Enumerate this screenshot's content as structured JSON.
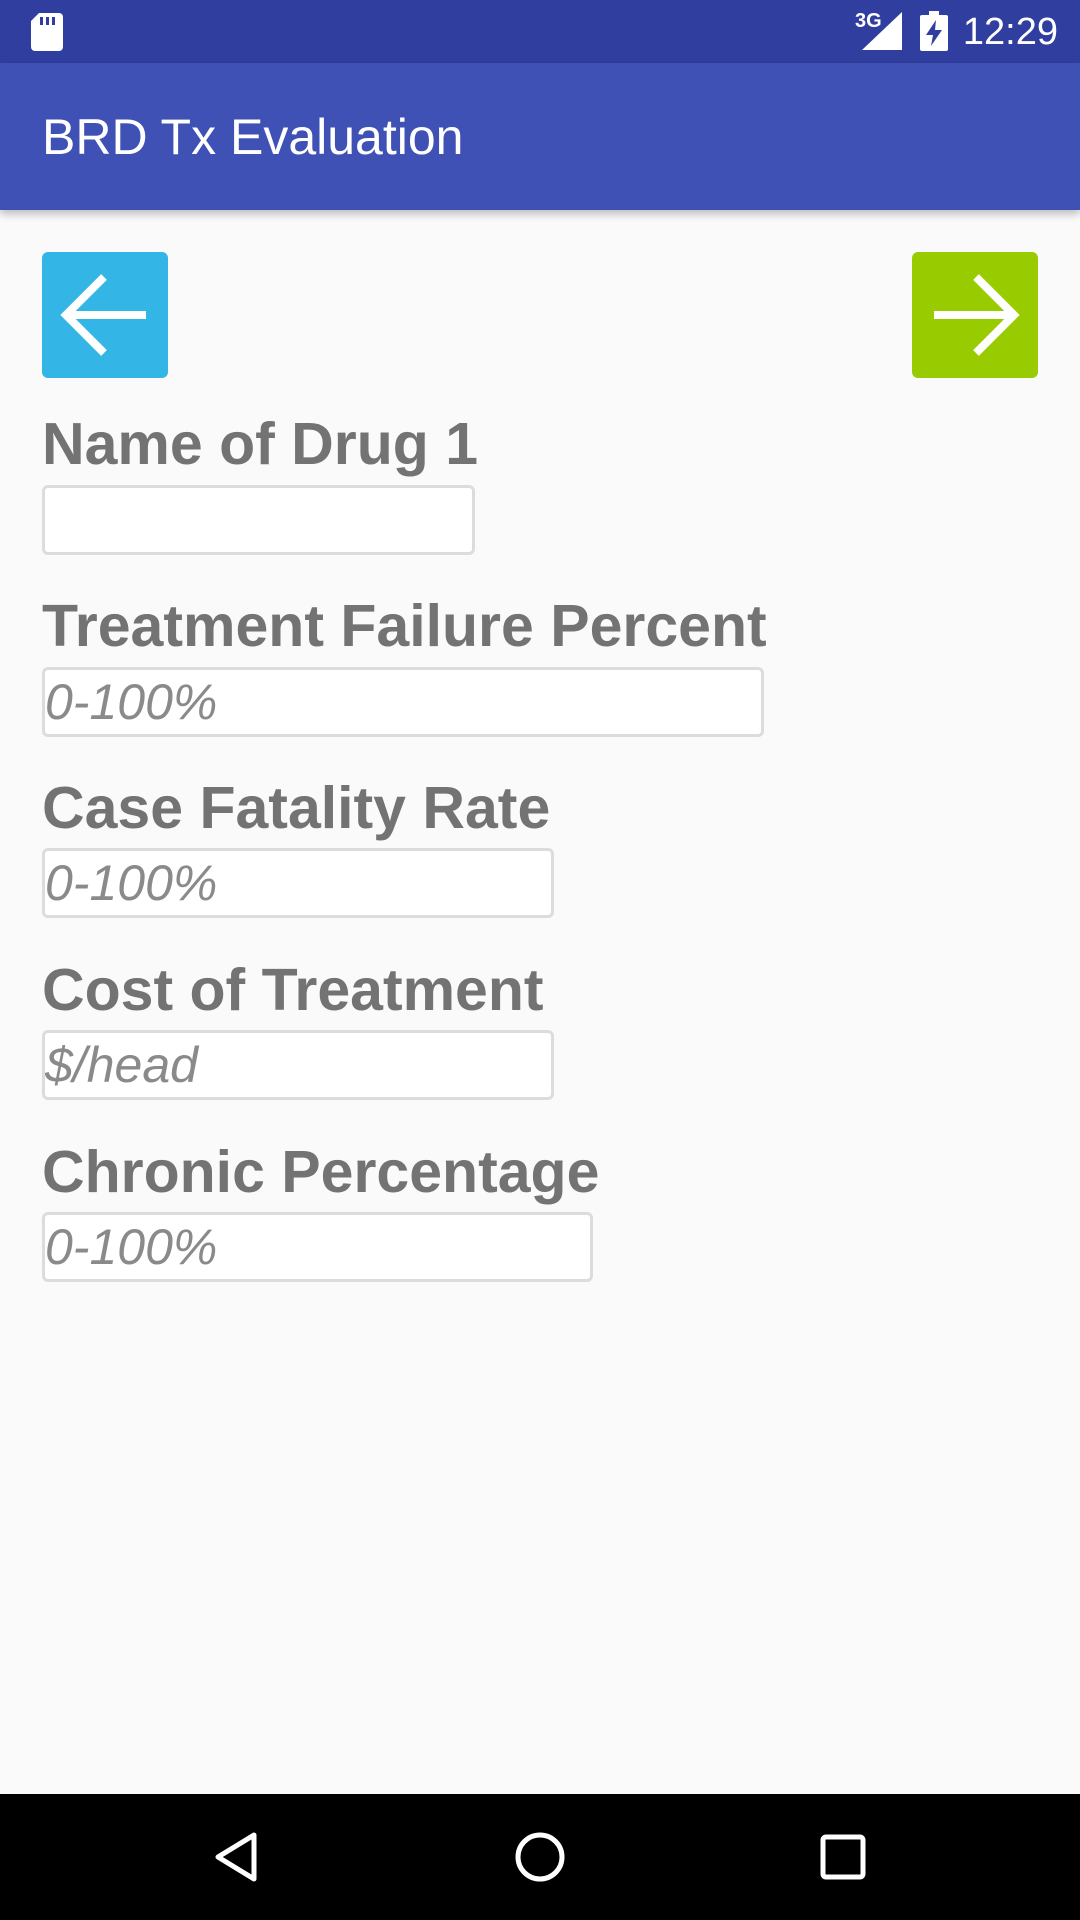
{
  "status_bar": {
    "network": "3G",
    "time": "12:29",
    "icons": [
      "sd-card-icon",
      "signal-icon",
      "battery-charging-icon"
    ]
  },
  "app_bar": {
    "title": "BRD Tx Evaluation"
  },
  "navigation": {
    "back_icon": "arrow-left-icon",
    "next_icon": "arrow-right-icon",
    "back_color": "#33b5e5",
    "next_color": "#99cc00"
  },
  "form": {
    "drug_name": {
      "label": "Name of Drug 1",
      "value": "",
      "placeholder": ""
    },
    "treatment_failure": {
      "label": "Treatment Failure Percent",
      "value": "",
      "placeholder": "0-100%"
    },
    "case_fatality": {
      "label": "Case Fatality Rate",
      "value": "",
      "placeholder": "0-100%"
    },
    "treatment_cost": {
      "label": "Cost of Treatment",
      "value": "",
      "placeholder": "$/head"
    },
    "chronic_percentage": {
      "label": "Chronic Percentage",
      "value": "",
      "placeholder": "0-100%"
    }
  },
  "system_nav": {
    "icons": [
      "back-triangle-icon",
      "home-circle-icon",
      "recents-square-icon"
    ]
  },
  "colors": {
    "status_bar": "#303f9f",
    "app_bar": "#3f51b5",
    "label_text": "#737373",
    "background": "#fafafa"
  }
}
